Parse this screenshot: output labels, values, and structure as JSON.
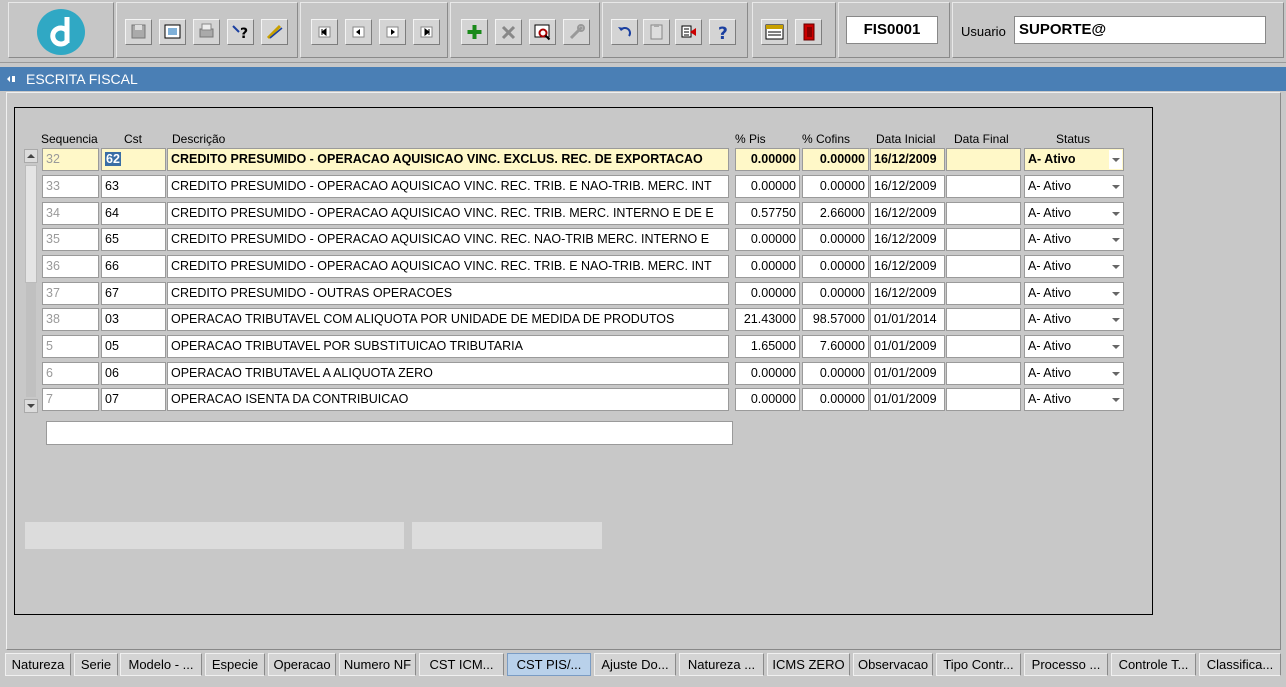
{
  "toolbar": {
    "form_code": "FIS0001",
    "user_label": "Usuario",
    "user_value": "SUPORTE@"
  },
  "window": {
    "title": "ESCRITA FISCAL"
  },
  "table": {
    "headers": {
      "sequencia": "Sequencia",
      "cst": "Cst",
      "descricao": "Descrição",
      "pis": "% Pis",
      "cofins": "% Cofins",
      "data_inicial": "Data Inicial",
      "data_final": "Data Final",
      "status": "Status"
    },
    "rows": [
      {
        "seq": "32",
        "cst": "62",
        "desc": "CREDITO PRESUMIDO - OPERACAO AQUISICAO VINC. EXCLUS. REC. DE EXPORTACAO",
        "pis": "0.00000",
        "cofins": "0.00000",
        "data_inicial": "16/12/2009",
        "data_final": "",
        "status": "A- Ativo"
      },
      {
        "seq": "33",
        "cst": "63",
        "desc": "CREDITO PRESUMIDO - OPERACAO AQUISICAO VINC. REC. TRIB. E NAO-TRIB. MERC. INT",
        "pis": "0.00000",
        "cofins": "0.00000",
        "data_inicial": "16/12/2009",
        "data_final": "",
        "status": "A- Ativo"
      },
      {
        "seq": "34",
        "cst": "64",
        "desc": "CREDITO PRESUMIDO - OPERACAO AQUISICAO VINC. REC. TRIB. MERC. INTERNO E DE E",
        "pis": "0.57750",
        "cofins": "2.66000",
        "data_inicial": "16/12/2009",
        "data_final": "",
        "status": "A- Ativo"
      },
      {
        "seq": "35",
        "cst": "65",
        "desc": "CREDITO PRESUMIDO - OPERACAO AQUISICAO VINC. REC. NAO-TRIB MERC. INTERNO E",
        "pis": "0.00000",
        "cofins": "0.00000",
        "data_inicial": "16/12/2009",
        "data_final": "",
        "status": "A- Ativo"
      },
      {
        "seq": "36",
        "cst": "66",
        "desc": "CREDITO PRESUMIDO - OPERACAO AQUISICAO VINC. REC. TRIB. E NAO-TRIB. MERC. INT",
        "pis": "0.00000",
        "cofins": "0.00000",
        "data_inicial": "16/12/2009",
        "data_final": "",
        "status": "A- Ativo"
      },
      {
        "seq": "37",
        "cst": "67",
        "desc": "CREDITO PRESUMIDO - OUTRAS OPERACOES",
        "pis": "0.00000",
        "cofins": "0.00000",
        "data_inicial": "16/12/2009",
        "data_final": "",
        "status": "A- Ativo"
      },
      {
        "seq": "38",
        "cst": "03",
        "desc": "OPERACAO TRIBUTAVEL COM ALIQUOTA POR UNIDADE DE MEDIDA DE PRODUTOS",
        "pis": "21.43000",
        "cofins": "98.57000",
        "data_inicial": "01/01/2014",
        "data_final": "",
        "status": "A- Ativo"
      },
      {
        "seq": "5",
        "cst": "05",
        "desc": "OPERACAO TRIBUTAVEL POR SUBSTITUICAO TRIBUTARIA",
        "pis": "1.65000",
        "cofins": "7.60000",
        "data_inicial": "01/01/2009",
        "data_final": "",
        "status": "A- Ativo"
      },
      {
        "seq": "6",
        "cst": "06",
        "desc": "OPERACAO TRIBUTAVEL A ALIQUOTA ZERO",
        "pis": "0.00000",
        "cofins": "0.00000",
        "data_inicial": "01/01/2009",
        "data_final": "",
        "status": "A- Ativo"
      },
      {
        "seq": "7",
        "cst": "07",
        "desc": "OPERACAO ISENTA DA CONTRIBUICAO",
        "pis": "0.00000",
        "cofins": "0.00000",
        "data_inicial": "01/01/2009",
        "data_final": "",
        "status": "A- Ativo"
      }
    ]
  },
  "tabs": [
    {
      "label": "Natureza",
      "active": false
    },
    {
      "label": "Serie",
      "active": false
    },
    {
      "label": "Modelo - ...",
      "active": false
    },
    {
      "label": "Especie",
      "active": false
    },
    {
      "label": "Operacao",
      "active": false
    },
    {
      "label": "Numero NF",
      "active": false
    },
    {
      "label": "CST ICM...",
      "active": false
    },
    {
      "label": "CST PIS/...",
      "active": true
    },
    {
      "label": "Ajuste Do...",
      "active": false
    },
    {
      "label": "Natureza ...",
      "active": false
    },
    {
      "label": "ICMS ZERO",
      "active": false
    },
    {
      "label": "Observacao",
      "active": false
    },
    {
      "label": "Tipo Contr...",
      "active": false
    },
    {
      "label": "Processo ...",
      "active": false
    },
    {
      "label": "Controle T...",
      "active": false
    },
    {
      "label": "Classifica...",
      "active": false
    }
  ],
  "icons": [
    "logo-icon",
    "save-icon",
    "screen-icon",
    "print-icon",
    "help-query-icon",
    "edit-icon",
    "first-record-icon",
    "previous-record-icon",
    "next-record-icon",
    "last-record-icon",
    "add-record-icon",
    "delete-record-icon",
    "search-icon",
    "tool-icon",
    "undo-icon",
    "clipboard-icon",
    "list-icon",
    "help-icon",
    "menu-icon",
    "exit-icon"
  ],
  "colors": {
    "title_bar": "#4a7fb5",
    "current_row": "#fff8c8",
    "active_tab": "#b9d1ea",
    "logo": "#30a8c4"
  }
}
